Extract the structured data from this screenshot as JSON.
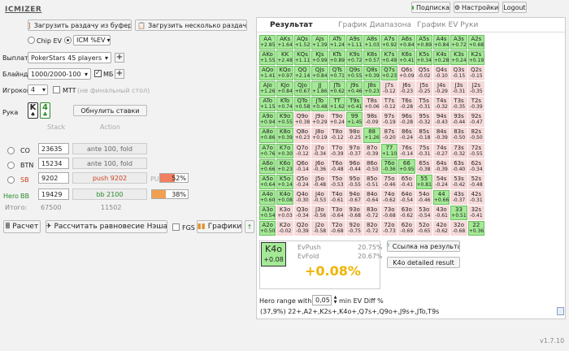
{
  "app": {
    "logo": "ICMIZER",
    "version": "v1.7.10"
  },
  "topbar": {
    "subscription": "Подписка",
    "settings": "Настройки",
    "logout": "Logout"
  },
  "left": {
    "load_from_buffer": "Загрузить раздачу из буфера",
    "load_multiple": "Загрузить несколько раздач или тур",
    "chip_ev": "Chip EV",
    "icm_ev": "ICM %EV",
    "payouts_label": "Выплаты",
    "payouts_value": "PokerStars 45 players",
    "blinds_label": "Блайнды",
    "blinds_value": "1000/2000-100",
    "mb_label": "МБ",
    "players_label": "Игроков",
    "players_value": "4",
    "mtt_label": "MTT",
    "mtt_note": "(не финальный стол)",
    "hand_label": "Рука",
    "card1": "K",
    "card2": "4",
    "reset_button": "Обнулить ставки",
    "stack_header": "Stack",
    "action_header": "Action",
    "positions": [
      {
        "name": "CO",
        "stack": "23635",
        "action": "ante 100, fold"
      },
      {
        "name": "BTN",
        "stack": "15234",
        "action": "ante 100, fold"
      },
      {
        "name": "SB",
        "stack": "9202",
        "action": "push 9202",
        "pu": "PU",
        "percent": "52%",
        "fill": 0.52
      },
      {
        "hero": "Hero",
        "name": "BB",
        "stack": "19429",
        "action": "bb 2100",
        "percent": "38%",
        "fill": 0.38
      }
    ],
    "total_label": "Итого:",
    "total_stack": "67500",
    "total_action": "11502",
    "calc_button": "Расчет",
    "nash_button": "Рассчитать равновесие Нэша",
    "fgs_label": "FGS",
    "charts_button": "Графики"
  },
  "tabs": [
    "Результат",
    "График Диапазона",
    "График EV Руки"
  ],
  "grid_cells": [
    [
      [
        "AA",
        "+2.85",
        "p"
      ],
      [
        "AKs",
        "+1.64",
        "p"
      ],
      [
        "AQs",
        "+1.52",
        "p"
      ],
      [
        "AJs",
        "+1.39",
        "p"
      ],
      [
        "ATs",
        "+1.24",
        "p"
      ],
      [
        "A9s",
        "+1.11",
        "p"
      ],
      [
        "A8s",
        "+1.03",
        "p"
      ],
      [
        "A7s",
        "+0.92",
        "p"
      ],
      [
        "A6s",
        "+0.84",
        "p"
      ],
      [
        "A5s",
        "+0.89",
        "p"
      ],
      [
        "A4s",
        "+0.84",
        "p"
      ],
      [
        "A3s",
        "+0.72",
        "p"
      ],
      [
        "A2s",
        "+0.68",
        "p"
      ]
    ],
    [
      [
        "AKo",
        "+1.55",
        "p"
      ],
      [
        "KK",
        "+2.48",
        "p"
      ],
      [
        "KQs",
        "+1.11",
        "p"
      ],
      [
        "KJs",
        "+0.99",
        "p"
      ],
      [
        "KTs",
        "+0.89",
        "p"
      ],
      [
        "K9s",
        "+0.72",
        "p"
      ],
      [
        "K8s",
        "+0.57",
        "p"
      ],
      [
        "K7s",
        "+0.49",
        "p"
      ],
      [
        "K6s",
        "+0.41",
        "p"
      ],
      [
        "K5s",
        "+0.34",
        "p"
      ],
      [
        "K4s",
        "+0.28",
        "p"
      ],
      [
        "K3s",
        "+0.24",
        "p"
      ],
      [
        "K2s",
        "+0.19",
        "p"
      ]
    ],
    [
      [
        "AQo",
        "+1.41",
        "p"
      ],
      [
        "KQo",
        "+0.97",
        "p"
      ],
      [
        "QQ",
        "+2.14",
        "p"
      ],
      [
        "QJs",
        "+0.84",
        "p"
      ],
      [
        "QTs",
        "+0.71",
        "p"
      ],
      [
        "Q9s",
        "+0.55",
        "p"
      ],
      [
        "Q8s",
        "+0.39",
        "p"
      ],
      [
        "Q7s",
        "+0.23",
        "p"
      ],
      [
        "Q6s",
        "+0.09",
        "n"
      ],
      [
        "Q5s",
        "-0.02",
        "n"
      ],
      [
        "Q4s",
        "-0.10",
        "n"
      ],
      [
        "Q3s",
        "-0.15",
        "n"
      ],
      [
        "Q2s",
        "-0.15",
        "n"
      ]
    ],
    [
      [
        "AJo",
        "+1.26",
        "p"
      ],
      [
        "KJo",
        "+0.84",
        "p"
      ],
      [
        "QJo",
        "+0.67",
        "p"
      ],
      [
        "JJ",
        "+1.86",
        "p"
      ],
      [
        "JTs",
        "+0.62",
        "p"
      ],
      [
        "J9s",
        "+0.46",
        "p"
      ],
      [
        "J8s",
        "+0.23",
        "p"
      ],
      [
        "J7s",
        "-0.12",
        "n"
      ],
      [
        "J6s",
        "-0.23",
        "n"
      ],
      [
        "J5s",
        "-0.25",
        "n"
      ],
      [
        "J4s",
        "-0.29",
        "n"
      ],
      [
        "J3s",
        "-0.31",
        "n"
      ],
      [
        "J2s",
        "-0.35",
        "n"
      ]
    ],
    [
      [
        "ATo",
        "+1.15",
        "p"
      ],
      [
        "KTo",
        "+0.74",
        "p"
      ],
      [
        "QTo",
        "+0.58",
        "p"
      ],
      [
        "JTo",
        "+0.48",
        "p"
      ],
      [
        "TT",
        "+1.62",
        "p"
      ],
      [
        "T9s",
        "+0.41",
        "p"
      ],
      [
        "T8s",
        "+0.06",
        "n"
      ],
      [
        "T7s",
        "-0.12",
        "n"
      ],
      [
        "T6s",
        "-0.28",
        "n"
      ],
      [
        "T5s",
        "-0.31",
        "n"
      ],
      [
        "T4s",
        "-0.32",
        "n"
      ],
      [
        "T3s",
        "-0.35",
        "n"
      ],
      [
        "T2s",
        "-0.39",
        "n"
      ]
    ],
    [
      [
        "A9o",
        "+0.94",
        "p"
      ],
      [
        "K9o",
        "+0.55",
        "p"
      ],
      [
        "Q9o",
        "+0.38",
        "n"
      ],
      [
        "J9o",
        "+0.29",
        "n"
      ],
      [
        "T9o",
        "+0.24",
        "n"
      ],
      [
        "99",
        "+1.45",
        "p"
      ],
      [
        "98s",
        "-0.09",
        "n"
      ],
      [
        "97s",
        "-0.19",
        "n"
      ],
      [
        "96s",
        "-0.28",
        "n"
      ],
      [
        "95s",
        "-0.32",
        "n"
      ],
      [
        "94s",
        "-0.43",
        "n"
      ],
      [
        "93s",
        "-0.44",
        "n"
      ],
      [
        "92s",
        "-0.47",
        "n"
      ]
    ],
    [
      [
        "A8o",
        "+0.86",
        "p"
      ],
      [
        "K8o",
        "+0.39",
        "p"
      ],
      [
        "Q8o",
        "+0.23",
        "n"
      ],
      [
        "J8o",
        "+0.19",
        "n"
      ],
      [
        "T8o",
        "-0.12",
        "n"
      ],
      [
        "98o",
        "-0.25",
        "n"
      ],
      [
        "88",
        "+1.26",
        "p"
      ],
      [
        "87s",
        "-0.20",
        "n"
      ],
      [
        "86s",
        "-0.24",
        "n"
      ],
      [
        "85s",
        "-0.18",
        "n"
      ],
      [
        "84s",
        "-0.39",
        "n"
      ],
      [
        "83s",
        "-0.50",
        "n"
      ],
      [
        "82s",
        "-0.50",
        "n"
      ]
    ],
    [
      [
        "A7o",
        "+0.76",
        "p"
      ],
      [
        "K7o",
        "+0.30",
        "p"
      ],
      [
        "Q7o",
        "-0.12",
        "n"
      ],
      [
        "J7o",
        "-0.34",
        "n"
      ],
      [
        "T7o",
        "-0.39",
        "n"
      ],
      [
        "97o",
        "-0.37",
        "n"
      ],
      [
        "87o",
        "-0.39",
        "n"
      ],
      [
        "77",
        "+1.10",
        "p"
      ],
      [
        "76s",
        "-0.14",
        "n"
      ],
      [
        "75s",
        "-0.31",
        "n"
      ],
      [
        "74s",
        "-0.27",
        "n"
      ],
      [
        "73s",
        "-0.32",
        "n"
      ],
      [
        "72s",
        "-0.55",
        "n"
      ]
    ],
    [
      [
        "A6o",
        "+0.66",
        "p"
      ],
      [
        "K6o",
        "+0.23",
        "p"
      ],
      [
        "Q6o",
        "-0.14",
        "n"
      ],
      [
        "J6o",
        "-0.36",
        "n"
      ],
      [
        "T6o",
        "-0.48",
        "n"
      ],
      [
        "96o",
        "-0.44",
        "n"
      ],
      [
        "86o",
        "-0.50",
        "n"
      ],
      [
        "76o",
        "-0.36",
        "p"
      ],
      [
        "66",
        "+0.95",
        "p"
      ],
      [
        "65s",
        "-0.38",
        "n"
      ],
      [
        "64s",
        "-0.39",
        "n"
      ],
      [
        "63s",
        "-0.40",
        "n"
      ],
      [
        "62s",
        "-0.34",
        "n"
      ]
    ],
    [
      [
        "A5o",
        "+0.64",
        "p"
      ],
      [
        "K5o",
        "+0.14",
        "p"
      ],
      [
        "Q5o",
        "-0.24",
        "n"
      ],
      [
        "J5o",
        "-0.48",
        "n"
      ],
      [
        "T5o",
        "-0.53",
        "n"
      ],
      [
        "95o",
        "-0.55",
        "n"
      ],
      [
        "85o",
        "-0.51",
        "n"
      ],
      [
        "75o",
        "-0.46",
        "n"
      ],
      [
        "65o",
        "-0.41",
        "n"
      ],
      [
        "55",
        "+0.81",
        "p"
      ],
      [
        "54s",
        "-0.24",
        "n"
      ],
      [
        "53s",
        "-0.42",
        "n"
      ],
      [
        "52s",
        "-0.48",
        "n"
      ]
    ],
    [
      [
        "A4o",
        "+0.60",
        "p"
      ],
      [
        "K4o",
        "+0.08",
        "p"
      ],
      [
        "Q4o",
        "-0.30",
        "n"
      ],
      [
        "J4o",
        "-0.53",
        "n"
      ],
      [
        "T4o",
        "-0.61",
        "n"
      ],
      [
        "94o",
        "-0.67",
        "n"
      ],
      [
        "84o",
        "-0.64",
        "n"
      ],
      [
        "74o",
        "-0.62",
        "n"
      ],
      [
        "64o",
        "-0.54",
        "n"
      ],
      [
        "54o",
        "-0.46",
        "n"
      ],
      [
        "44",
        "+0.66",
        "p"
      ],
      [
        "43s",
        "-0.37",
        "n"
      ],
      [
        "42s",
        "-0.31",
        "n"
      ]
    ],
    [
      [
        "A3o",
        "+0.54",
        "p"
      ],
      [
        "K3o",
        "+0.03",
        "n"
      ],
      [
        "Q3o",
        "-0.34",
        "n"
      ],
      [
        "J3o",
        "-0.56",
        "n"
      ],
      [
        "T3o",
        "-0.64",
        "n"
      ],
      [
        "93o",
        "-0.68",
        "n"
      ],
      [
        "83o",
        "-0.72",
        "n"
      ],
      [
        "73o",
        "-0.68",
        "n"
      ],
      [
        "63o",
        "-0.62",
        "n"
      ],
      [
        "53o",
        "-0.54",
        "n"
      ],
      [
        "43o",
        "-0.61",
        "n"
      ],
      [
        "33",
        "+0.51",
        "p"
      ],
      [
        "32s",
        "-0.41",
        "n"
      ]
    ],
    [
      [
        "A2o",
        "+0.50",
        "p"
      ],
      [
        "K2o",
        "-0.02",
        "n"
      ],
      [
        "Q2o",
        "-0.39",
        "n"
      ],
      [
        "J2o",
        "-0.58",
        "n"
      ],
      [
        "T2o",
        "-0.68",
        "n"
      ],
      [
        "92o",
        "-0.75",
        "n"
      ],
      [
        "82o",
        "-0.72",
        "n"
      ],
      [
        "72o",
        "-0.73",
        "n"
      ],
      [
        "62o",
        "-0.69",
        "n"
      ],
      [
        "52o",
        "-0.65",
        "n"
      ],
      [
        "42o",
        "-0.62",
        "n"
      ],
      [
        "32o",
        "-0.68",
        "n"
      ],
      [
        "22",
        "+0.36",
        "p"
      ]
    ]
  ],
  "result": {
    "hand": "K4o",
    "hand_ev": "+0.08",
    "evpush_label": "EvPush",
    "evpush_value": "20.75%",
    "evfold_label": "EvFold",
    "evfold_value": "20.67%",
    "diff": "+0.08%",
    "link_button": "Ссылка на результат",
    "detailed_button": "K4o detailed result",
    "range_label": "Hero range with",
    "range_value": "0,05",
    "range_suffix": "min EV Diff %",
    "range_text": "(37,9%) 22+,A2+,K2s+,K4o+,Q7s+,Q9o+,J9s+,JTo,T9s"
  },
  "colors": {
    "positive": "#a4ea96",
    "negative": "#f6dada",
    "gold": "#f0b400",
    "push_red": "#d04020",
    "bb_green": "#2a8a2a"
  }
}
